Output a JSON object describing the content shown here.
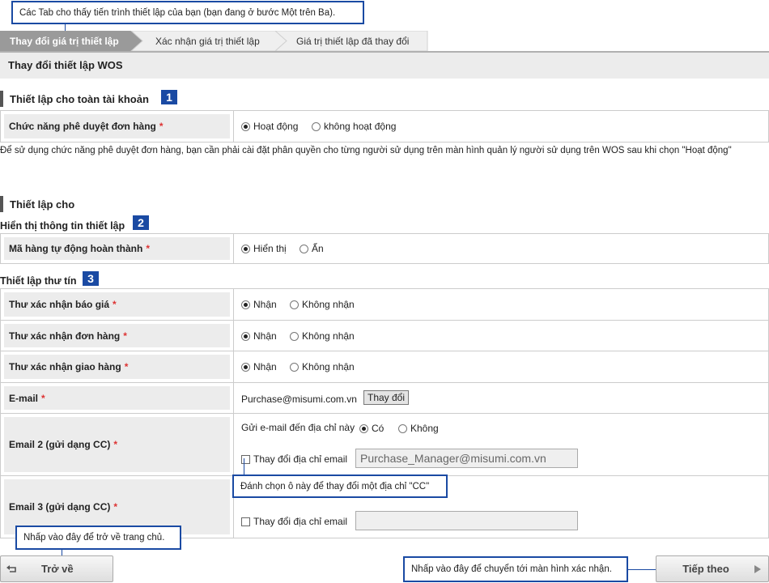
{
  "callouts": {
    "tabs_hint": "Các Tab cho thấy tiến trình thiết lập của bạn (bạn đang ở bước Một trên Ba).",
    "checkbox_hint": "Đánh chọn ô này để thay đổi một địa chỉ \"CC\"",
    "back_hint": "Nhấp vào đây để trở về trang chủ.",
    "next_hint": "Nhấp vào đây để chuyển tới màn hình xác nhận."
  },
  "tabs": [
    {
      "label": "Thay đổi giá trị thiết lập",
      "active": true
    },
    {
      "label": "Xác nhận giá trị thiết lập",
      "active": false
    },
    {
      "label": "Giá trị thiết lập đã thay đổi",
      "active": false
    }
  ],
  "page_title": "Thay đổi thiết lập WOS",
  "section1": {
    "title": "Thiết lập cho toàn tài khoản",
    "badge": "1",
    "approval_label": "Chức năng phê duyệt đơn hàng",
    "required_mark": "*",
    "opt_on": "Hoạt động",
    "opt_off": "không hoạt động",
    "note": "Để sử dụng chức năng phê duyệt đơn hàng, bạn cần phải cài đặt phân quyền cho từng người sử dụng trên màn hình quản lý người sử dụng trên WOS sau khi chọn \"Hoạt động\""
  },
  "section2": {
    "title": "Thiết lập cho",
    "display_subhead": "Hiển thị thông tin thiết lập",
    "display_badge": "2",
    "auto_complete_label": "Mã hàng tự động hoàn thành",
    "opt_show": "Hiển thị",
    "opt_hide": "Ẩn",
    "mail_subhead": "Thiết lập thư tín",
    "mail_badge": "3",
    "quote_label": "Thư xác nhận báo giá",
    "order_label": "Thư xác nhận đơn hàng",
    "delivery_label": "Thư xác nhận giao hàng",
    "opt_receive": "Nhận",
    "opt_no_receive": "Không nhận",
    "email_label": "E-mail",
    "email_value": "Purchase@misumi.com.vn",
    "change_button": "Thay đổi",
    "email2_label": "Email 2 (gửi dạng CC)",
    "send_to_label": "Gửi e-mail đến địa chỉ này",
    "opt_yes": "Có",
    "opt_no": "Không",
    "change_addr_label": "Thay đổi địa chỉ email",
    "email2_value": "Purchase_Manager@misumi.com.vn",
    "email3_label": "Email 3 (gửi dạng CC)",
    "email3_value": ""
  },
  "buttons": {
    "back": "Trở về",
    "next": "Tiếp theo"
  },
  "colors": {
    "accent": "#1a4aa3",
    "required": "#dd3333",
    "active_tab": "#9a9a9a"
  }
}
